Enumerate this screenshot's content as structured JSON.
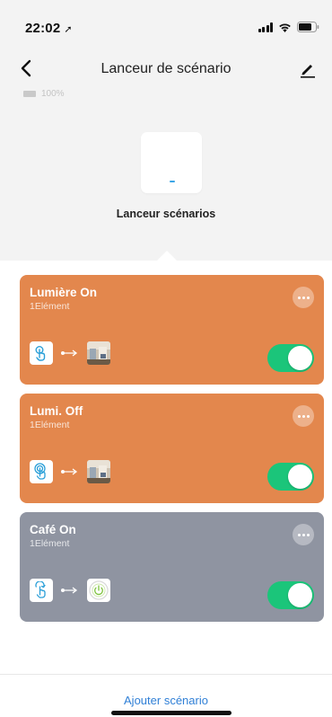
{
  "status": {
    "time": "22:02",
    "location_icon": "location-arrow-icon"
  },
  "header": {
    "title": "Lanceur de scénario",
    "back_icon": "chevron-left-icon",
    "edit_icon": "pencil-icon"
  },
  "device": {
    "battery_text": "100%",
    "name": "Lanceur scénarios"
  },
  "scenes": [
    {
      "title": "Lumière On",
      "subtitle": "1Elément",
      "color": "#e3874d",
      "trigger_icon": "single-tap-hand-icon",
      "enabled": true
    },
    {
      "title": "Lumi. Off",
      "subtitle": "1Elément",
      "color": "#e3874d",
      "trigger_icon": "double-tap-hand-icon",
      "enabled": true
    },
    {
      "title": "Café On",
      "subtitle": "1Elément",
      "color": "#8f94a1",
      "trigger_icon": "long-press-hand-icon",
      "enabled": true
    }
  ],
  "footer": {
    "add_label": "Ajouter scénario"
  },
  "colors": {
    "toggle_on": "#1bc57a",
    "link": "#2f7fd6"
  }
}
